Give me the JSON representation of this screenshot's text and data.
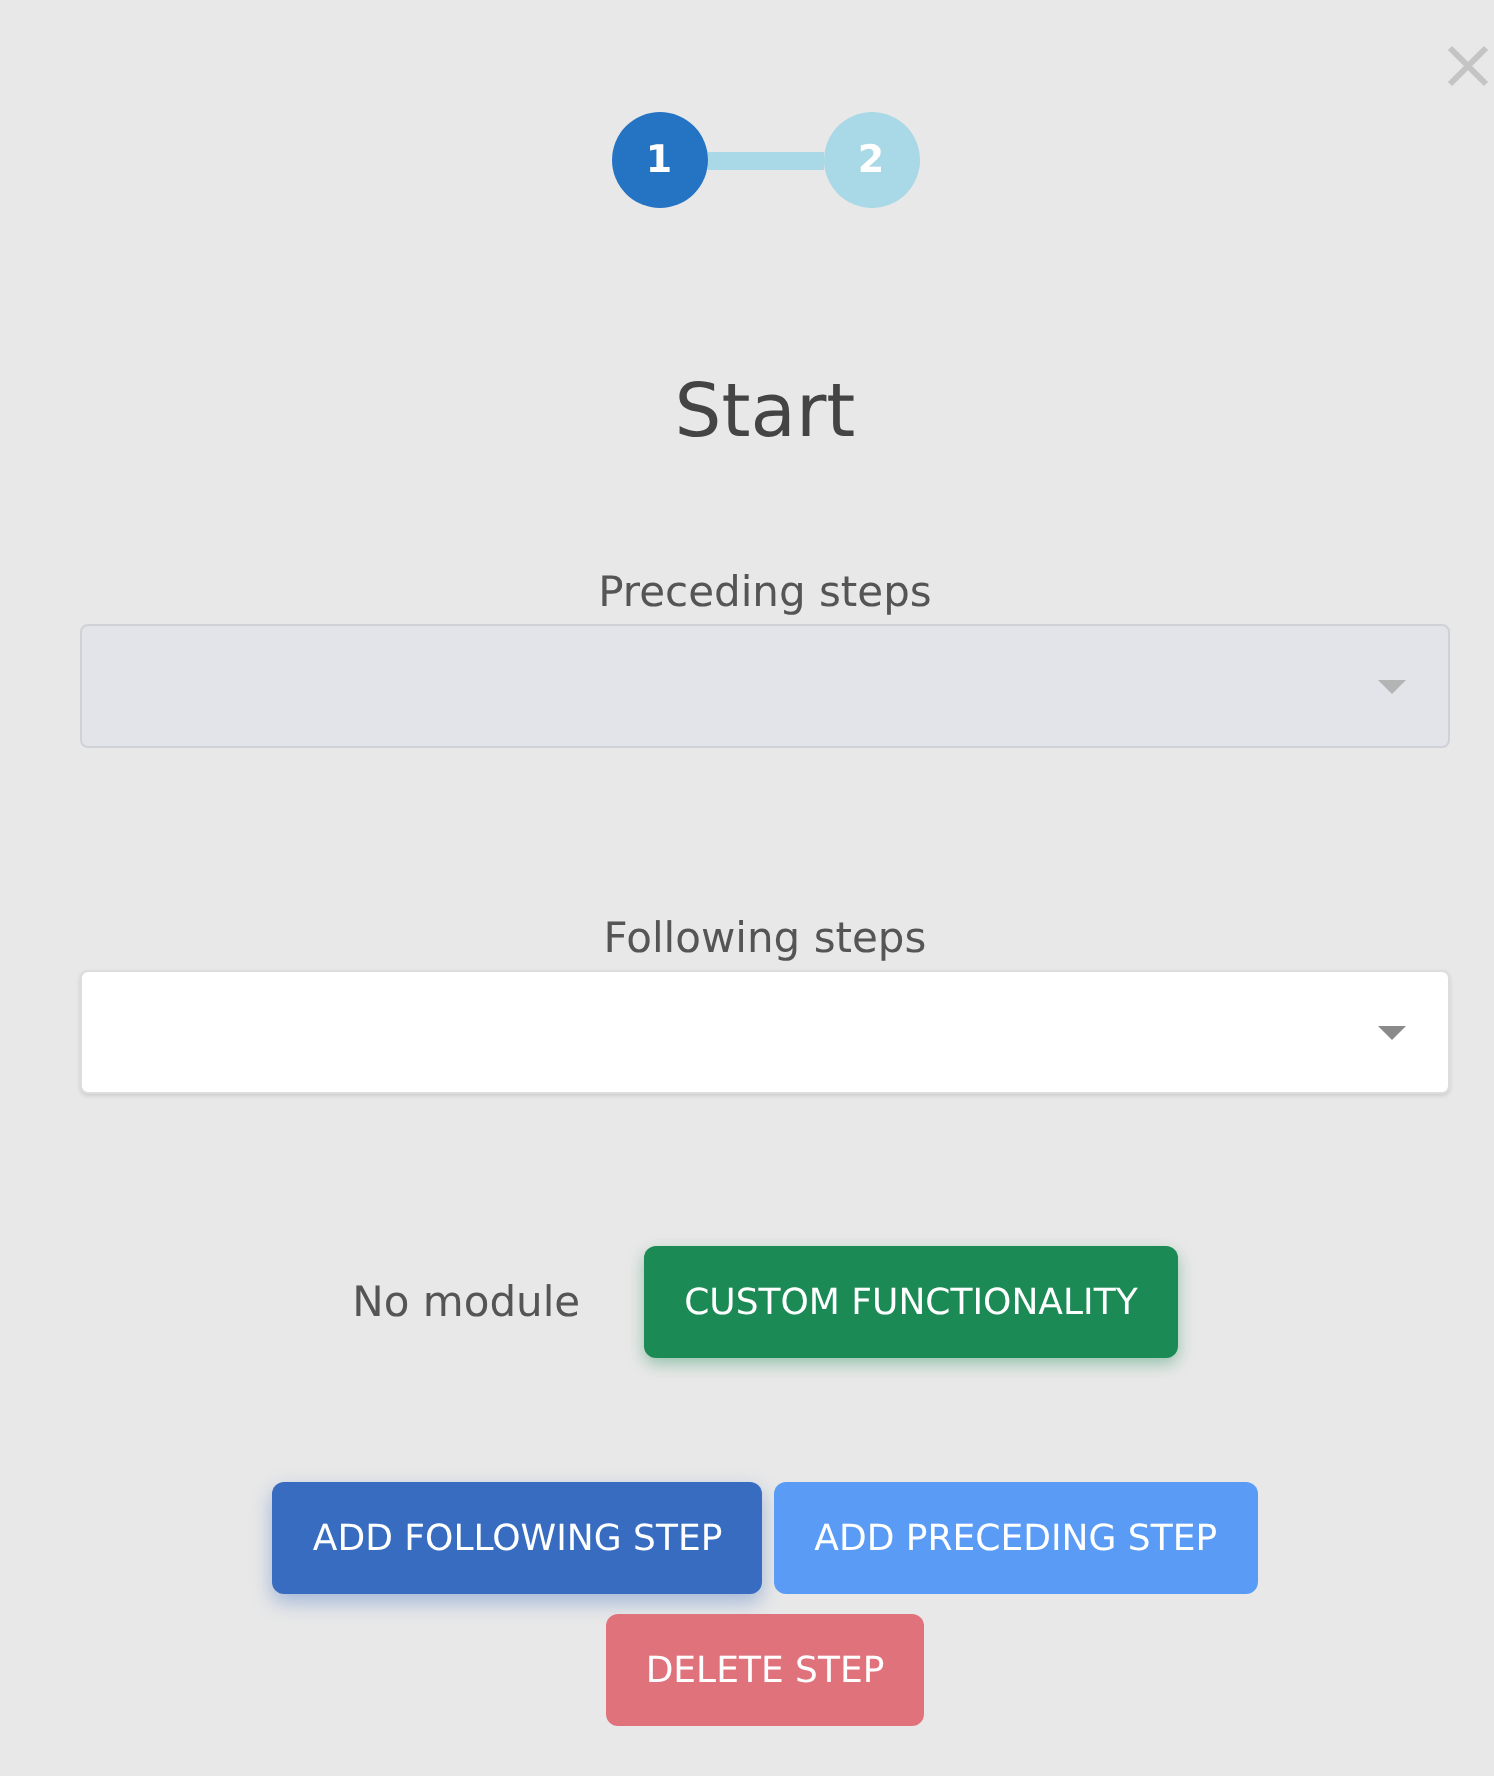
{
  "stepper": [
    {
      "label": "1",
      "selected": true
    },
    {
      "label": "2",
      "selected": false
    }
  ],
  "title": "Start",
  "fields": [
    {
      "label": "Preceding steps",
      "disabled": true
    },
    {
      "label": "Following steps",
      "disabled": false
    }
  ],
  "module": {
    "text": "No module",
    "button": "CUSTOM FUNCTIONALITY"
  },
  "actions": [
    {
      "label": "ADD FOLLOWING STEP",
      "kind": "primary"
    },
    {
      "label": "ADD PRECEDING STEP",
      "kind": "secondary"
    },
    {
      "label": "DELETE STEP",
      "kind": "danger"
    }
  ]
}
